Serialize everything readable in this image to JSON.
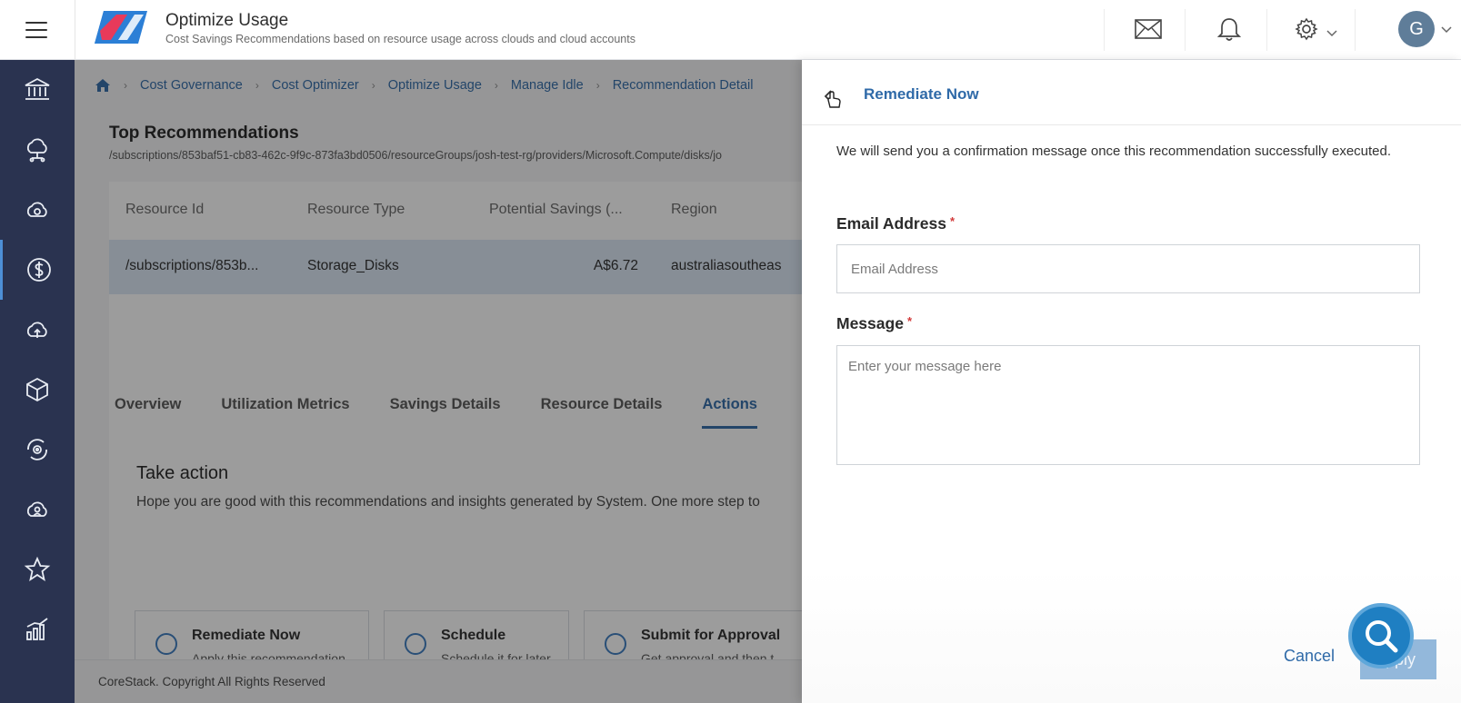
{
  "header": {
    "title": "Optimize Usage",
    "subtitle": "Cost Savings Recommendations based on resource usage across clouds and cloud accounts",
    "avatar_initial": "G"
  },
  "icons": {
    "menu": "hamburger-menu-icon",
    "mail": "mail-icon",
    "bell": "bell-icon",
    "settings": "gear-icon",
    "chevron": "chevron-down-icon",
    "search": "search-icon"
  },
  "sidebar": {
    "items": [
      {
        "icon": "bank-icon"
      },
      {
        "icon": "cloud-network-icon"
      },
      {
        "icon": "cloud-icon"
      },
      {
        "icon": "dollar-icon",
        "active": true
      },
      {
        "icon": "cloud-upload-icon"
      },
      {
        "icon": "cube-icon"
      },
      {
        "icon": "gear-cycle-icon"
      },
      {
        "icon": "cloud-user-icon"
      },
      {
        "icon": "star-icon"
      },
      {
        "icon": "bar-chart-icon"
      }
    ]
  },
  "breadcrumb": [
    "Cost Governance",
    "Cost Optimizer",
    "Optimize Usage",
    "Manage Idle",
    "Recommendation Detail"
  ],
  "main": {
    "section_title": "Top Recommendations",
    "resource_path": "/subscriptions/853baf51-cb83-462c-9f9c-873fa3bd0506/resourceGroups/josh-test-rg/providers/Microsoft.Compute/disks/jo",
    "table": {
      "columns": [
        "Resource Id",
        "Resource Type",
        "Potential Savings (...",
        "Region"
      ],
      "rows": [
        [
          "/subscriptions/853b...",
          "Storage_Disks",
          "A$6.72",
          "australiasoutheas"
        ]
      ]
    },
    "tabs": [
      "Overview",
      "Utilization Metrics",
      "Savings Details",
      "Resource Details",
      "Actions"
    ],
    "active_tab": "Actions",
    "take_action": {
      "title": "Take action",
      "description": "Hope you are good with this recommendations and insights generated by System. One more step to",
      "options": [
        {
          "title": "Remediate Now",
          "desc": "Apply this recommendation"
        },
        {
          "title": "Schedule",
          "desc": "Schedule it for later"
        },
        {
          "title": "Submit for Approval",
          "desc": "Get approval and then t"
        }
      ]
    },
    "footer": "CoreStack. Copyright All Rights Reserved"
  },
  "drawer": {
    "title": "Remediate Now",
    "message": "We will send you a confirmation message once this recommendation successfully executed.",
    "email_label": "Email Address",
    "email_placeholder": "Email Address",
    "message_label": "Message",
    "message_placeholder": "Enter your message here",
    "required_mark": "*",
    "cancel_label": "Cancel",
    "apply_label": "Apply"
  },
  "colors": {
    "accent": "#2f6aa8",
    "sidebar": "#2a3350",
    "selected_row": "#dbe7f4",
    "required": "#d23a3a"
  }
}
